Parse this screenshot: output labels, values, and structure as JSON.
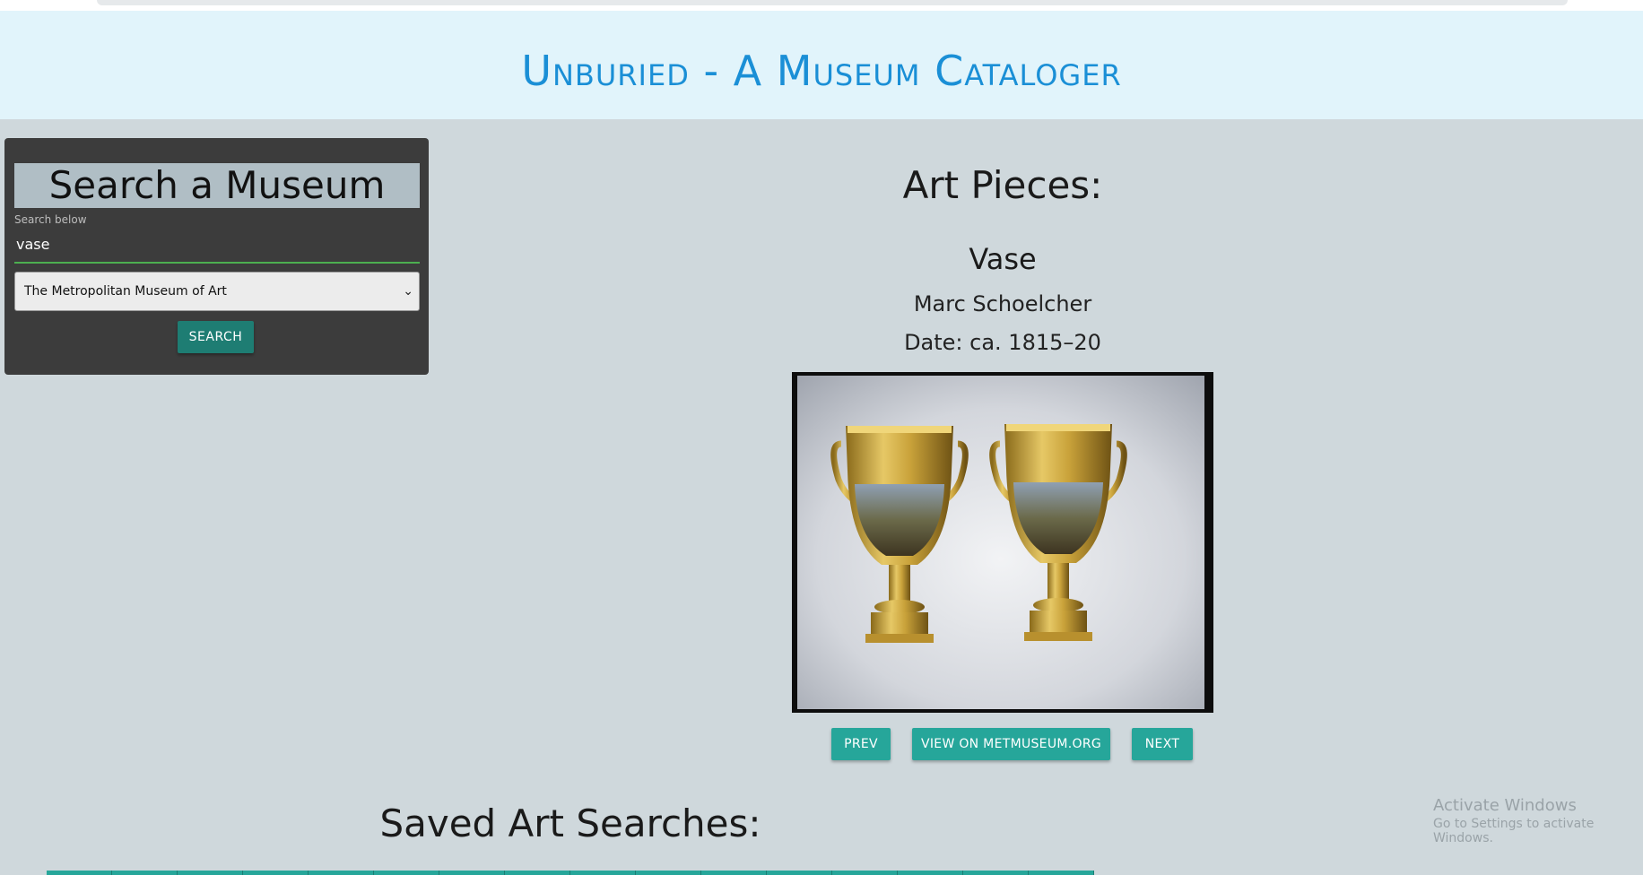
{
  "header": {
    "title": "Unburied - A Museum Cataloger"
  },
  "search_panel": {
    "heading": "Search a Museum",
    "search_label": "Search below",
    "search_value": "vase",
    "museum_selected": "The Metropolitan Museum of Art",
    "search_button_label": "SEARCH"
  },
  "art": {
    "section_title": "Art Pieces:",
    "title": "Vase",
    "artist": "Marc Schoelcher",
    "date": "Date: ca. 1815–20",
    "image_subject": "two-gilded-porcelain-vases",
    "prev_label": "PREV",
    "view_label": "VIEW ON METMUSEUM.ORG",
    "next_label": "NEXT"
  },
  "saved": {
    "title": "Saved Art Searches:"
  },
  "os_watermark": {
    "line1": "Activate Windows",
    "line2": "Go to Settings to activate Windows."
  },
  "colors": {
    "page_bg": "#cfd8dc",
    "header_bg": "#e1f4fb",
    "title_blue": "#1a8fd6",
    "panel_bg": "#3c3c3c",
    "teal_button": "#26a69a",
    "dark_teal_button": "#1e7d73"
  }
}
